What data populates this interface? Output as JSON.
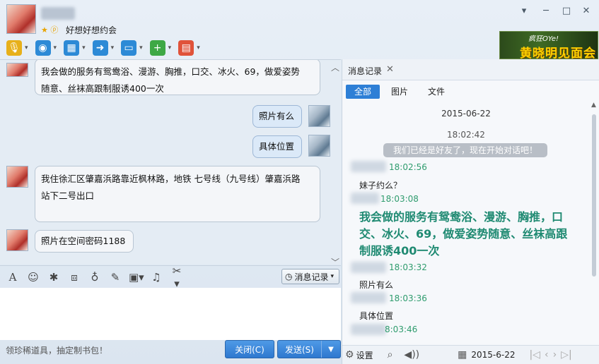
{
  "window": {
    "signature": "好想好想约会",
    "status_icons": "★ ⓟ",
    "ad_top": "疯狂OYe!",
    "ad_text": "黄晓明见面会",
    "min_label": "▾",
    "restore_label": "─",
    "max_label": "□",
    "close_label": "✕"
  },
  "toolbar": [
    {
      "name": "voice-call-icon",
      "color": "#e7b01a",
      "glyph": "🎙"
    },
    {
      "name": "video-call-icon",
      "color": "#2d8ad6",
      "glyph": "◉"
    },
    {
      "name": "remote-desktop-icon",
      "color": "#2d8ad6",
      "glyph": "▦"
    },
    {
      "name": "send-file-icon",
      "color": "#2d8ad6",
      "glyph": "➜"
    },
    {
      "name": "screen-share-icon",
      "color": "#2d8ad6",
      "glyph": "▭"
    },
    {
      "name": "add-chat-icon",
      "color": "#3ea845",
      "glyph": "+"
    },
    {
      "name": "apps-icon",
      "color": "#e0533a",
      "glyph": "▤"
    }
  ],
  "chat": {
    "messages": [
      {
        "side": "them",
        "text1": "我会做的服务有鸳鸯浴、漫游、胸推，口交、冰火、69，做爱姿势",
        "text2": "随意、丝袜高跟制服诱400一次"
      },
      {
        "side": "me",
        "text1": "照片有么"
      },
      {
        "side": "me",
        "text1": "具体位置"
      },
      {
        "side": "them",
        "text1": "我住徐汇区肇嘉浜路靠近枫林路，地铁 七号线（九号线）肇嘉浜路",
        "text2": "站下二号出口"
      },
      {
        "side": "them",
        "text1": "照片在空间密码1188"
      }
    ]
  },
  "input_toolbar": {
    "history_label": "消息记录",
    "icons": [
      "font-icon",
      "emoji-icon",
      "magic-icon",
      "screenshot-region-icon",
      "voice-message-icon",
      "edit-icon",
      "image-icon",
      "music-icon",
      "scissors-icon"
    ]
  },
  "footer": {
    "tip": "领珍稀道具，抽定制书包！",
    "close_label": "关闭(C)",
    "send_label": "发送(S)"
  },
  "history": {
    "tab_label": "消息记录",
    "filters": [
      "全部",
      "图片",
      "文件"
    ],
    "date": "2015-06-22",
    "first_time": "18:02:42",
    "system_msg": "我们已经是好友了，现在开始对话吧！",
    "entries": [
      {
        "ts": "18:02:56",
        "text": "妹子约么？",
        "big": false
      },
      {
        "ts": "18:03:08",
        "text": "我会做的服务有鸳鸯浴、漫游、胸推，口交、冰火、69，做爱姿势随意、丝袜高跟制服诱400一次",
        "big": true
      },
      {
        "ts": "18:03:32",
        "text": "照片有么",
        "big": false
      },
      {
        "ts": "18:03:36",
        "text": "具体位置",
        "big": false
      },
      {
        "ts": "8:03:46",
        "text": "",
        "big": false
      }
    ],
    "settings_label": "设置",
    "date_picker": "2015-6-22"
  }
}
